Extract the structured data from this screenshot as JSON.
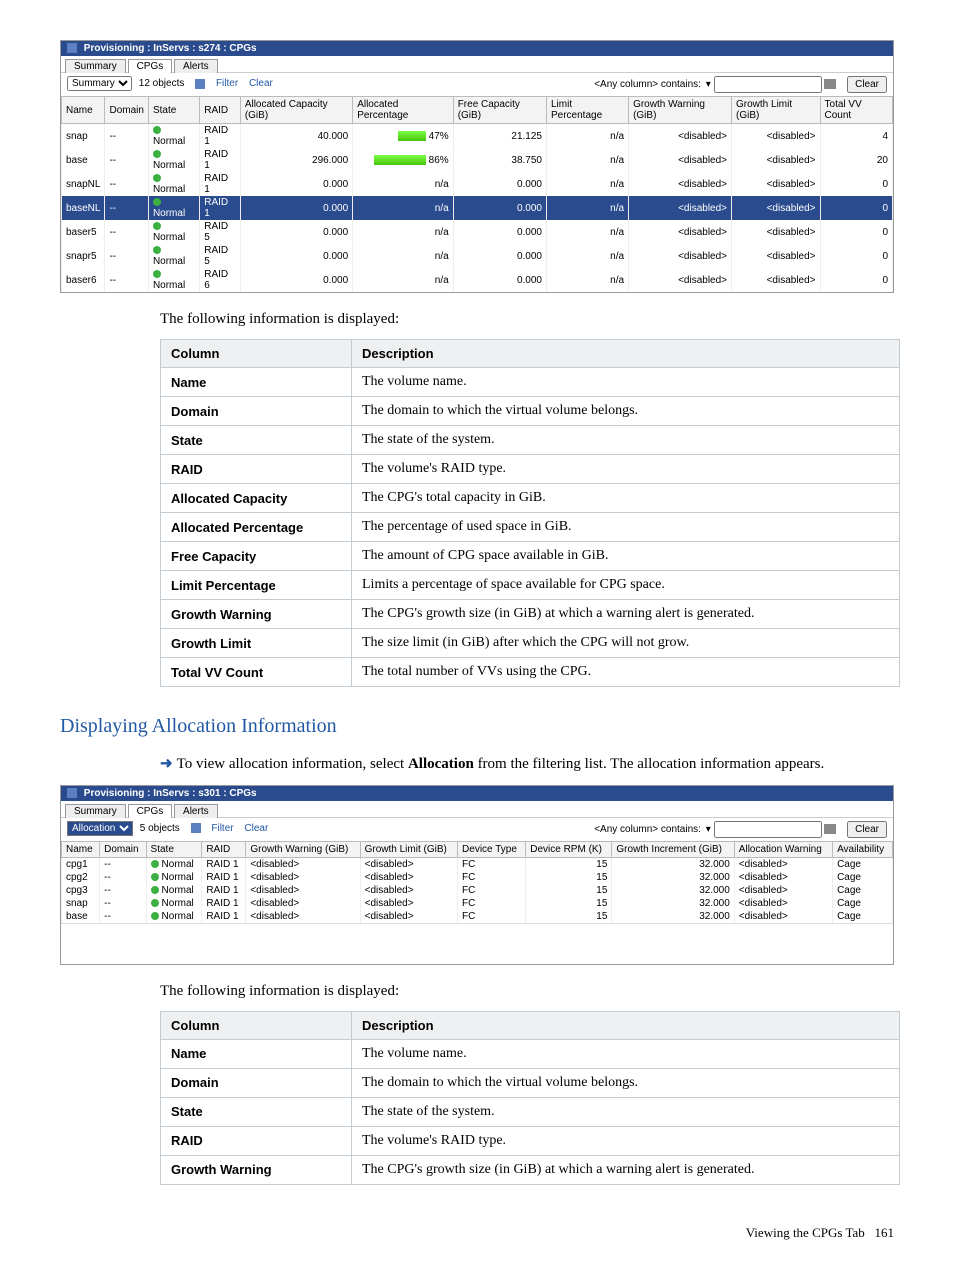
{
  "screenshot1": {
    "title": "Provisioning : InServs : s274 : CPGs",
    "tabs": [
      "Summary",
      "CPGs",
      "Alerts"
    ],
    "filter_selector": "Summary",
    "object_count": "12 objects",
    "filter_link": "Filter",
    "clear_link": "Clear",
    "anycol": "<Any column> contains:",
    "clear_button": "Clear",
    "headers": [
      "Name",
      "Domain",
      "State",
      "RAID",
      "Allocated Capacity (GiB)",
      "Allocated Percentage",
      "Free Capacity (GiB)",
      "Limit Percentage",
      "Growth Warning (GiB)",
      "Growth Limit (GiB)",
      "Total VV Count"
    ],
    "rows": [
      {
        "name": "snap",
        "domain": "--",
        "state": "Normal",
        "raid": "RAID 1",
        "alloc_cap": "40.000",
        "alloc_pct": "47%",
        "pct_num": 47,
        "free": "21.125",
        "limit": "n/a",
        "gw": "<disabled>",
        "gl": "<disabled>",
        "vv": "4"
      },
      {
        "name": "base",
        "domain": "--",
        "state": "Normal",
        "raid": "RAID 1",
        "alloc_cap": "296.000",
        "alloc_pct": "86%",
        "pct_num": 86,
        "free": "38.750",
        "limit": "n/a",
        "gw": "<disabled>",
        "gl": "<disabled>",
        "vv": "20"
      },
      {
        "name": "snapNL",
        "domain": "--",
        "state": "Normal",
        "raid": "RAID 1",
        "alloc_cap": "0.000",
        "alloc_pct": "n/a",
        "pct_num": 0,
        "free": "0.000",
        "limit": "n/a",
        "gw": "<disabled>",
        "gl": "<disabled>",
        "vv": "0"
      },
      {
        "name": "baseNL",
        "domain": "--",
        "state": "Normal",
        "raid": "RAID 1",
        "alloc_cap": "0.000",
        "alloc_pct": "n/a",
        "pct_num": 0,
        "free": "0.000",
        "limit": "n/a",
        "gw": "<disabled>",
        "gl": "<disabled>",
        "vv": "0",
        "selected": true
      },
      {
        "name": "baser5",
        "domain": "--",
        "state": "Normal",
        "raid": "RAID 5",
        "alloc_cap": "0.000",
        "alloc_pct": "n/a",
        "pct_num": 0,
        "free": "0.000",
        "limit": "n/a",
        "gw": "<disabled>",
        "gl": "<disabled>",
        "vv": "0"
      },
      {
        "name": "snapr5",
        "domain": "--",
        "state": "Normal",
        "raid": "RAID 5",
        "alloc_cap": "0.000",
        "alloc_pct": "n/a",
        "pct_num": 0,
        "free": "0.000",
        "limit": "n/a",
        "gw": "<disabled>",
        "gl": "<disabled>",
        "vv": "0"
      },
      {
        "name": "baser6",
        "domain": "--",
        "state": "Normal",
        "raid": "RAID 6",
        "alloc_cap": "0.000",
        "alloc_pct": "n/a",
        "pct_num": 0,
        "free": "0.000",
        "limit": "n/a",
        "gw": "<disabled>",
        "gl": "<disabled>",
        "vv": "0"
      }
    ]
  },
  "text1": "The following information is displayed:",
  "table1": {
    "head": [
      "Column",
      "Description"
    ],
    "rows": [
      [
        "Name",
        "The volume name."
      ],
      [
        "Domain",
        "The domain to which the virtual volume belongs."
      ],
      [
        "State",
        "The state of the system."
      ],
      [
        "RAID",
        "The volume's RAID type."
      ],
      [
        "Allocated Capacity",
        "The CPG's total capacity in GiB."
      ],
      [
        "Allocated Percentage",
        "The percentage of used space in GiB."
      ],
      [
        "Free Capacity",
        "The amount of CPG space available in GiB."
      ],
      [
        "Limit Percentage",
        "Limits a percentage of space available for CPG space."
      ],
      [
        "Growth Warning",
        "The CPG's growth size (in GiB) at which a warning alert is generated."
      ],
      [
        "Growth Limit",
        "The size limit (in GiB) after which the CPG will not grow."
      ],
      [
        "Total VV Count",
        "The total number of VVs using the CPG."
      ]
    ]
  },
  "section_title": "Displaying Allocation Information",
  "text2a": "To view allocation information, select ",
  "text2b": "Allocation",
  "text2c": " from the filtering list. The allocation information appears.",
  "screenshot2": {
    "title": "Provisioning : InServs : s301 : CPGs",
    "tabs": [
      "Summary",
      "CPGs",
      "Alerts"
    ],
    "filter_selector": "Allocation",
    "object_count": "5 objects",
    "filter_link": "Filter",
    "clear_link": "Clear",
    "anycol": "<Any column> contains:",
    "clear_button": "Clear",
    "headers": [
      "Name",
      "Domain",
      "State",
      "RAID",
      "Growth Warning (GiB)",
      "Growth Limit (GiB)",
      "Device Type",
      "Device RPM (K)",
      "Growth Increment (GiB)",
      "Allocation Warning",
      "Availability"
    ],
    "rows": [
      {
        "name": "cpg1",
        "domain": "--",
        "state": "Normal",
        "raid": "RAID 1",
        "gw": "<disabled>",
        "gl": "<disabled>",
        "dt": "FC",
        "rpm": "15",
        "gi": "32.000",
        "aw": "<disabled>",
        "av": "Cage"
      },
      {
        "name": "cpg2",
        "domain": "--",
        "state": "Normal",
        "raid": "RAID 1",
        "gw": "<disabled>",
        "gl": "<disabled>",
        "dt": "FC",
        "rpm": "15",
        "gi": "32.000",
        "aw": "<disabled>",
        "av": "Cage"
      },
      {
        "name": "cpg3",
        "domain": "--",
        "state": "Normal",
        "raid": "RAID 1",
        "gw": "<disabled>",
        "gl": "<disabled>",
        "dt": "FC",
        "rpm": "15",
        "gi": "32.000",
        "aw": "<disabled>",
        "av": "Cage"
      },
      {
        "name": "snap",
        "domain": "--",
        "state": "Normal",
        "raid": "RAID 1",
        "gw": "<disabled>",
        "gl": "<disabled>",
        "dt": "FC",
        "rpm": "15",
        "gi": "32.000",
        "aw": "<disabled>",
        "av": "Cage"
      },
      {
        "name": "base",
        "domain": "--",
        "state": "Normal",
        "raid": "RAID 1",
        "gw": "<disabled>",
        "gl": "<disabled>",
        "dt": "FC",
        "rpm": "15",
        "gi": "32.000",
        "aw": "<disabled>",
        "av": "Cage"
      }
    ]
  },
  "text3": "The following information is displayed:",
  "table2": {
    "head": [
      "Column",
      "Description"
    ],
    "rows": [
      [
        "Name",
        "The volume name."
      ],
      [
        "Domain",
        "The domain to which the virtual volume belongs."
      ],
      [
        "State",
        "The state of the system."
      ],
      [
        "RAID",
        "The volume's RAID type."
      ],
      [
        "Growth Warning",
        "The CPG's growth size (in GiB) at which a warning alert is generated."
      ]
    ]
  },
  "footer_label": "Viewing the CPGs Tab",
  "footer_page": "161"
}
